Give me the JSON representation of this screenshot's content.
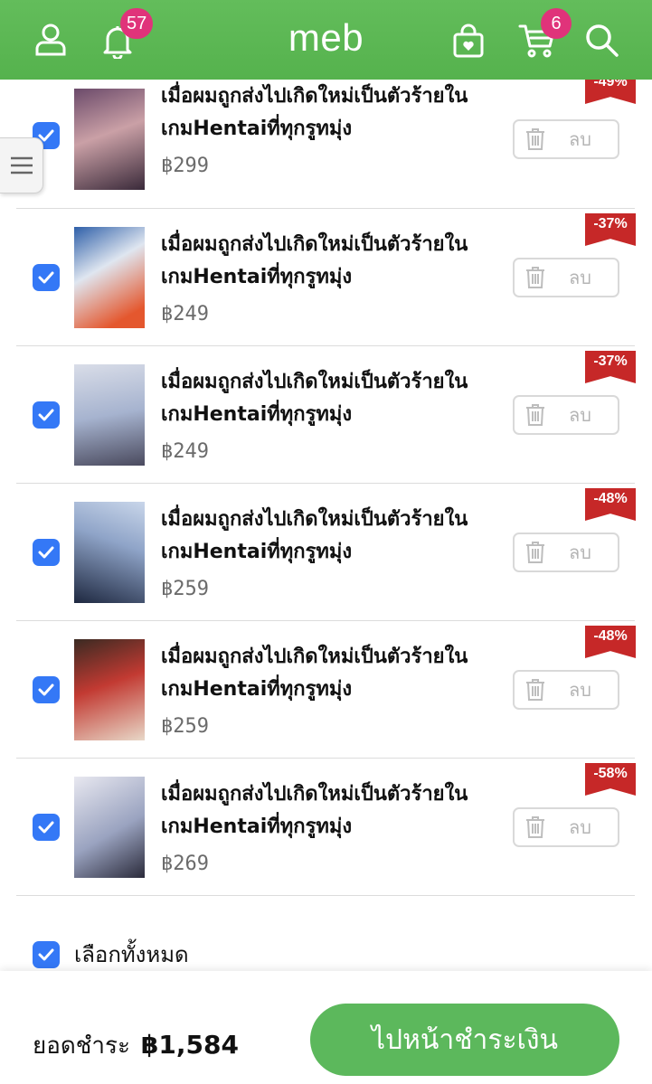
{
  "header": {
    "logo": "meb",
    "notification_count": "57",
    "cart_count": "6"
  },
  "items": [
    {
      "title": "เมื่อผมถูกส่งไปเกิดใหม่เป็นตัวร้ายในเกมHentaiที่ทุกรูทมุ่ง",
      "price": "฿299",
      "discount": "-49%",
      "delete_label": "ลบ",
      "cover_colors": [
        "#6b4a6a",
        "#caa0a6",
        "#3a2a3a"
      ]
    },
    {
      "title": "เมื่อผมถูกส่งไปเกิดใหม่เป็นตัวร้ายในเกมHentaiที่ทุกรูทมุ่ง",
      "price": "฿249",
      "discount": "-37%",
      "delete_label": "ลบ",
      "cover_colors": [
        "#2e5fa8",
        "#e4572e",
        "#dfe6f0"
      ]
    },
    {
      "title": "เมื่อผมถูกส่งไปเกิดใหม่เป็นตัวร้ายในเกมHentaiที่ทุกรูทมุ่ง",
      "price": "฿249",
      "discount": "-37%",
      "delete_label": "ลบ",
      "cover_colors": [
        "#d9dde8",
        "#a6b3cf",
        "#4a4a5e"
      ]
    },
    {
      "title": "เมื่อผมถูกส่งไปเกิดใหม่เป็นตัวร้ายในเกมHentaiที่ทุกรูทมุ่ง",
      "price": "฿259",
      "discount": "-48%",
      "delete_label": "ลบ",
      "cover_colors": [
        "#1e2840",
        "#8fa4c8",
        "#c9d6ea"
      ]
    },
    {
      "title": "เมื่อผมถูกส่งไปเกิดใหม่เป็นตัวร้ายในเกมHentaiที่ทุกรูทมุ่ง",
      "price": "฿259",
      "discount": "-48%",
      "delete_label": "ลบ",
      "cover_colors": [
        "#3a2a22",
        "#c23a32",
        "#e8d8c8"
      ]
    },
    {
      "title": "เมื่อผมถูกส่งไปเกิดใหม่เป็นตัวร้ายในเกมHentaiที่ทุกรูทมุ่ง",
      "price": "฿269",
      "discount": "-58%",
      "delete_label": "ลบ",
      "cover_colors": [
        "#e8e8f0",
        "#9aa3c0",
        "#2a2a3a"
      ]
    }
  ],
  "select_all_label": "เลือกทั้งหมด",
  "footer": {
    "total_label": "ยอดชำระ",
    "total_amount": "฿1,584",
    "pay_button": "ไปหน้าชำระเงิน"
  },
  "colors": {
    "header_green": "#5bb853",
    "badge_pink": "#e0337a",
    "checkbox_blue": "#3478f6",
    "discount_red": "#c62828",
    "pay_button_green": "#5cb85c"
  },
  "icons": [
    "user-icon",
    "bell-icon",
    "basket-icon",
    "cart-icon",
    "search-icon",
    "menu-icon",
    "trash-icon",
    "checkmark-icon"
  ]
}
